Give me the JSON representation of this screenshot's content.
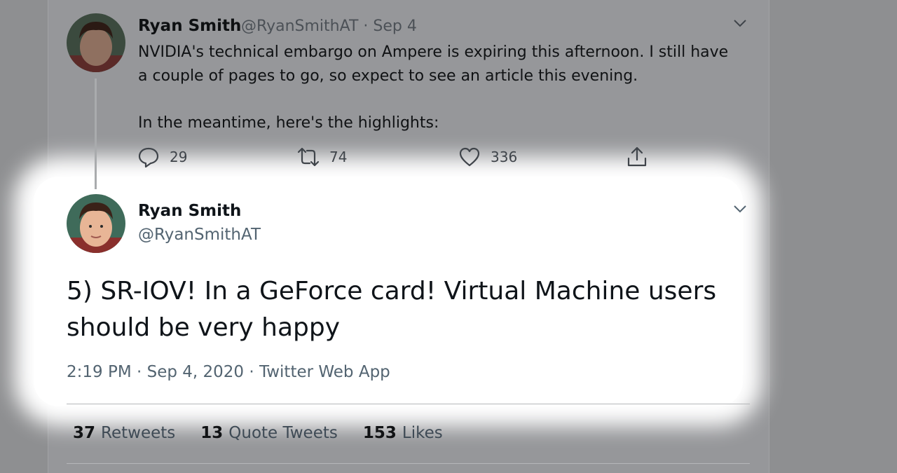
{
  "parent_tweet": {
    "author_name": "Ryan Smith",
    "handle_date": "@RyanSmithAT · Sep 4",
    "body_lines": [
      "NVIDIA's technical embargo on Ampere is expiring this afternoon. I still have",
      "a couple of pages to go, so expect to see an article this evening.",
      "In the meantime, here's the highlights:"
    ],
    "actions": {
      "replies": "29",
      "retweets": "74",
      "likes": "336"
    }
  },
  "main_tweet": {
    "author_name": "Ryan Smith",
    "handle": "@RyanSmithAT",
    "text": "5) SR-IOV! In a GeForce card! Virtual Machine users should be very happy",
    "meta": "2:19 PM · Sep 4, 2020 · Twitter Web App",
    "stats": {
      "retweets_count": "37",
      "retweets_label": "Retweets",
      "quote_count": "13",
      "quote_label": "Quote Tweets",
      "likes_count": "153",
      "likes_label": "Likes"
    }
  },
  "icons": {
    "reply": "reply-icon",
    "retweet": "retweet-icon",
    "like": "heart-icon",
    "share": "share-icon",
    "more": "chevron-down-icon"
  },
  "colors": {
    "spotlight": "#ffffff",
    "dimmed_background": "#96979a",
    "secondary_text": "#536471"
  }
}
